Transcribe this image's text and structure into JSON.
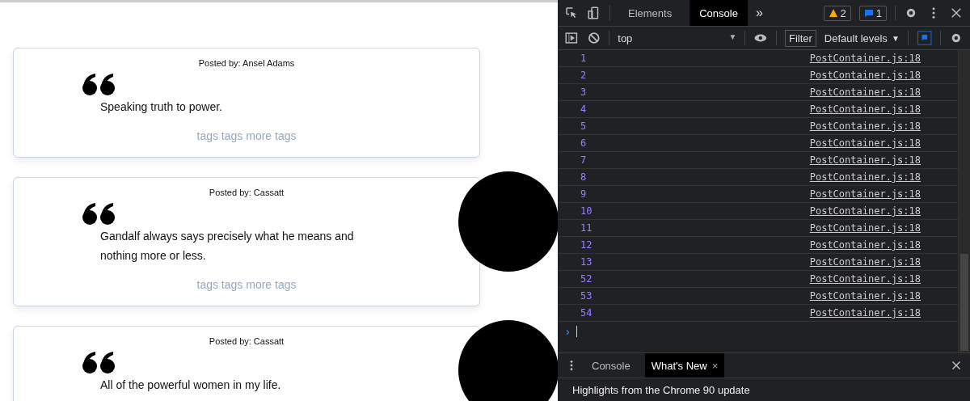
{
  "posts": [
    {
      "author": "Posted by: Ansel Adams",
      "quote": "Speaking truth to power.",
      "tags": "tags tags more tags",
      "avatar": false
    },
    {
      "author": "Posted by: Cassatt",
      "quote": "Gandalf always says precisely what he means and nothing more or less.",
      "tags": "tags tags more tags",
      "avatar": true
    },
    {
      "author": "Posted by: Cassatt",
      "quote": "All of the powerful women in my life.",
      "avatar": true
    }
  ],
  "devtools": {
    "tabs": [
      {
        "label": "Elements",
        "selected": false
      },
      {
        "label": "Console",
        "selected": true
      }
    ],
    "more": "»",
    "warnings": "2",
    "messages": "1",
    "context": "top",
    "context_arrow": "▼",
    "filter_placeholder": "Filter",
    "levels": "Default levels",
    "levels_arrow": "▼",
    "logs": [
      {
        "value": "1",
        "source": "PostContainer.js:18"
      },
      {
        "value": "2",
        "source": "PostContainer.js:18"
      },
      {
        "value": "3",
        "source": "PostContainer.js:18"
      },
      {
        "value": "4",
        "source": "PostContainer.js:18"
      },
      {
        "value": "5",
        "source": "PostContainer.js:18"
      },
      {
        "value": "6",
        "source": "PostContainer.js:18"
      },
      {
        "value": "7",
        "source": "PostContainer.js:18"
      },
      {
        "value": "8",
        "source": "PostContainer.js:18"
      },
      {
        "value": "9",
        "source": "PostContainer.js:18"
      },
      {
        "value": "10",
        "source": "PostContainer.js:18"
      },
      {
        "value": "11",
        "source": "PostContainer.js:18"
      },
      {
        "value": "12",
        "source": "PostContainer.js:18"
      },
      {
        "value": "13",
        "source": "PostContainer.js:18"
      },
      {
        "value": "52",
        "source": "PostContainer.js:18"
      },
      {
        "value": "53",
        "source": "PostContainer.js:18"
      },
      {
        "value": "54",
        "source": "PostContainer.js:18"
      }
    ],
    "prompt": "›",
    "drawer_tabs": [
      {
        "label": "Console",
        "selected": false
      },
      {
        "label": "What's New",
        "selected": true,
        "close": "×"
      }
    ],
    "drawer_text": "Highlights from the Chrome 90 update"
  }
}
